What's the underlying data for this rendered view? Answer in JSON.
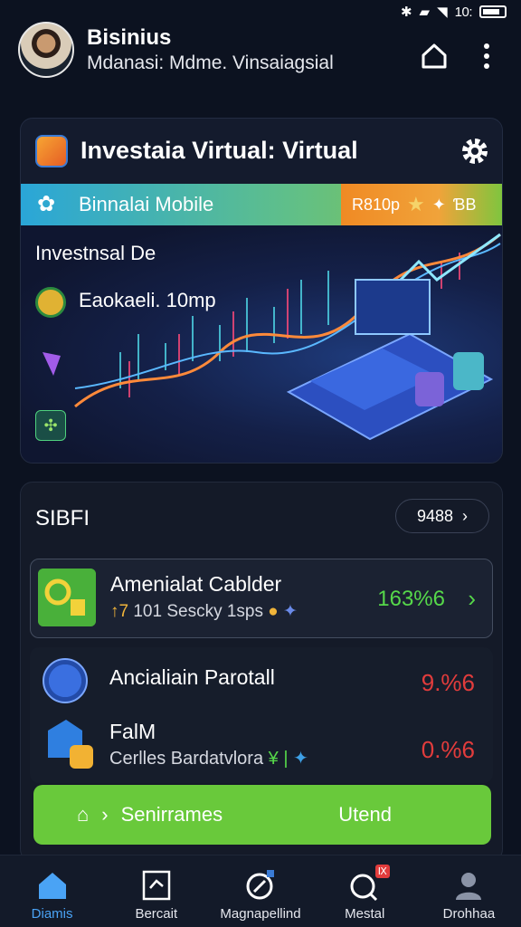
{
  "status_bar": {
    "time": "10:"
  },
  "header": {
    "name": "Bisinius",
    "subtitle": "Mdanasi: Mdme. Vinsaiagsial"
  },
  "invest_card": {
    "title": "Investaia Virtual: Virtual",
    "banner_label": "Binnalai Mobile",
    "banner_badge": "R810p",
    "banner_badge_extra": "ƁB",
    "chart_heading": "Investnsal De",
    "coin_label": "Eaokaeli. 10mp"
  },
  "list": {
    "section_title": "SIBFI",
    "filter_value": "9488",
    "rows": [
      {
        "title": "Amenialat Cablder",
        "sub_prefix": "↑7",
        "sub_text": "101 Sescky 1sps",
        "value": "163%6"
      },
      {
        "title": "Ancialiain Parotall",
        "value": "9.%6"
      },
      {
        "title": "FalM",
        "sub_text": "Cerlles Bardatvlora",
        "sub_glyph1": "¥",
        "sub_glyph2": "|",
        "value": "0.%6"
      }
    ],
    "cta_left": "Senirrames",
    "cta_right": "Utend"
  },
  "nav": [
    {
      "label": "Diamis",
      "active": true
    },
    {
      "label": "Bercait"
    },
    {
      "label": "Magnapellind"
    },
    {
      "label": "Mestal",
      "badge": "Ⅸ"
    },
    {
      "label": "Drohhaa"
    }
  ]
}
